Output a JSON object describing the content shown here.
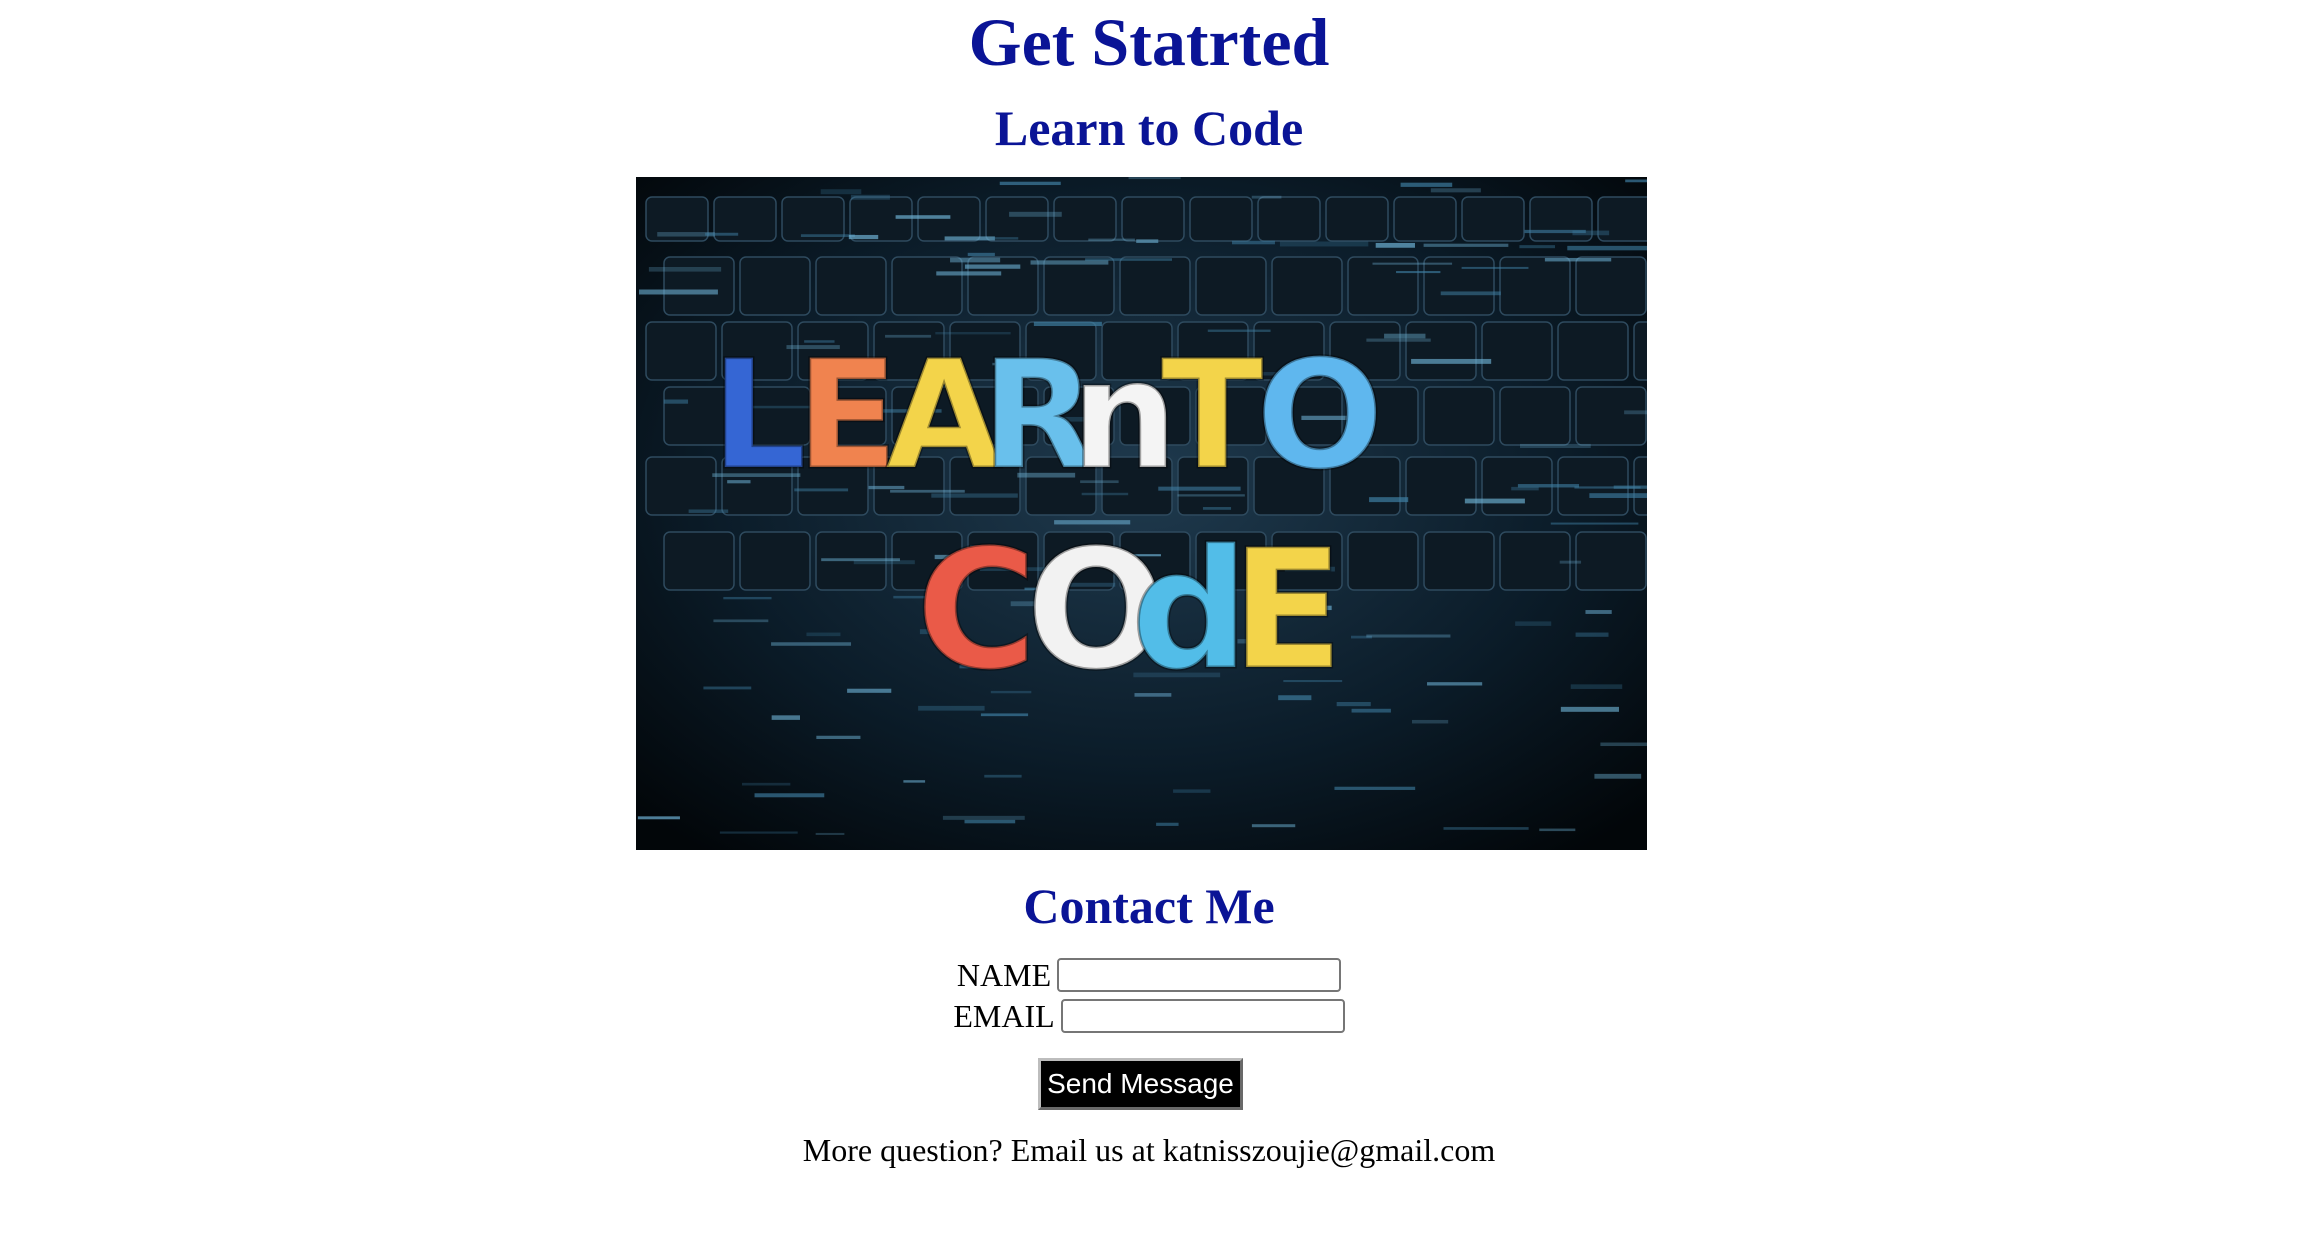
{
  "header": {
    "title": "Get Statrted",
    "subtitle": "Learn to Code"
  },
  "hero_image": {
    "alt": "LEARN TO CODE",
    "line1": [
      "L",
      "E",
      "A",
      "R",
      "n",
      "T",
      "O"
    ],
    "line2": [
      "C",
      "O",
      "d",
      "E"
    ],
    "letter_colors": [
      "#3566d4",
      "#f0834f",
      "#f3d44a",
      "#69c0ec",
      "#f4f4f4",
      "#f3d44a",
      "#5fb7ee",
      "#ea5a48",
      "#f2f2f2",
      "#52bde8",
      "#f3d44a"
    ],
    "background_color": "#06101a"
  },
  "contact": {
    "title": "Contact Me",
    "name_label": "NAME",
    "name_value": "",
    "email_label": "EMAIL",
    "email_value": "",
    "submit_label": "Send Message"
  },
  "footer": {
    "prefix": "More question? Email us at ",
    "email": "katnisszoujie@gmail.com"
  }
}
